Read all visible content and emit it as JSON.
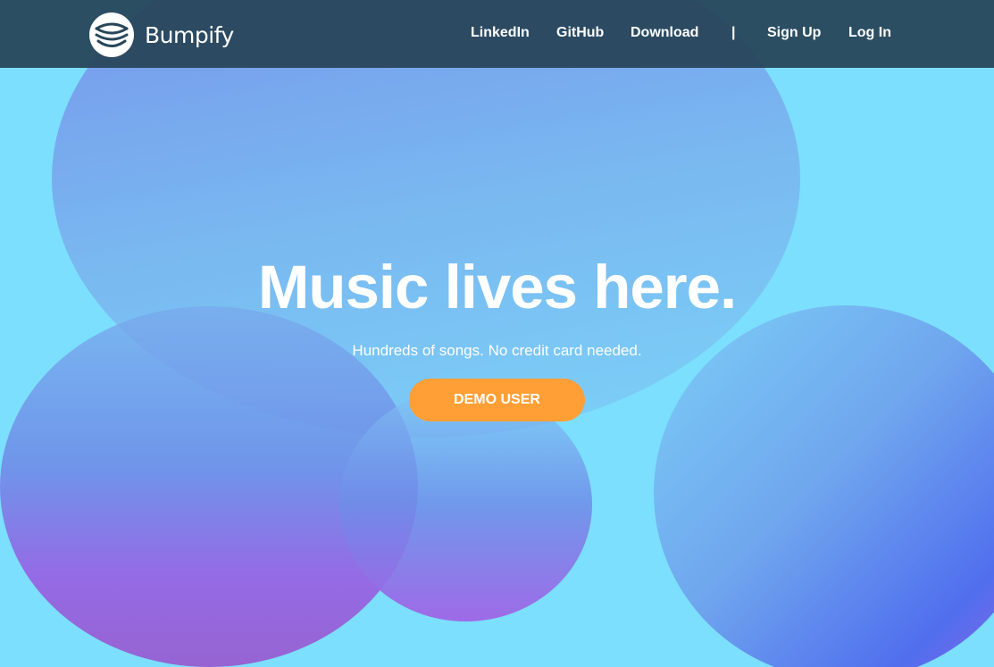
{
  "brand": {
    "name": "Bumpify",
    "logo_icon": "bumpify-logo-icon"
  },
  "nav": {
    "links": [
      {
        "label": "LinkedIn"
      },
      {
        "label": "GitHub"
      },
      {
        "label": "Download"
      }
    ],
    "separator": "|",
    "auth": [
      {
        "label": "Sign Up"
      },
      {
        "label": "Log In"
      }
    ]
  },
  "hero": {
    "title": "Music lives here.",
    "subtitle": "Hundreds of songs. No credit card needed.",
    "cta_label": "DEMO USER"
  },
  "colors": {
    "background": "#7cdffd",
    "navbar": "#28465a",
    "cta": "#ff9f36",
    "text": "#ffffff"
  }
}
